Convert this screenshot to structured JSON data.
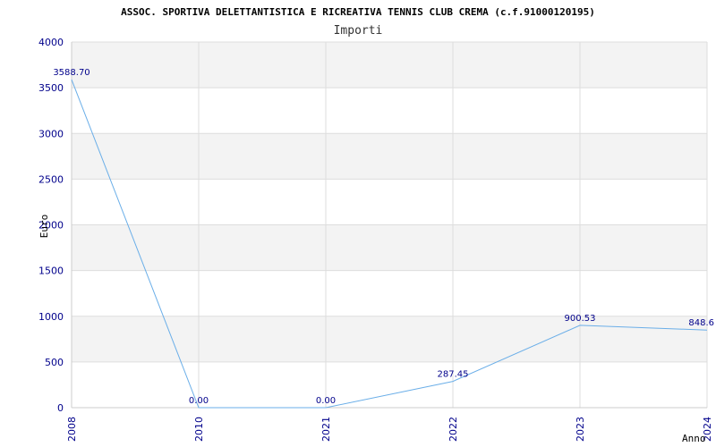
{
  "chart_data": {
    "type": "line",
    "title": "ASSOC. SPORTIVA DELETTANTISTICA E RICREATIVA TENNIS CLUB CREMA (c.f.91000120195)",
    "subtitle": "Importi",
    "xlabel": "Anno",
    "ylabel": "Euro",
    "categories": [
      "2008",
      "2010",
      "2021",
      "2022",
      "2023",
      "2024"
    ],
    "series": [
      {
        "values": [
          3588.7,
          0.0,
          0.0,
          287.45,
          900.53,
          848.6
        ],
        "labels": [
          "3588.70",
          "0.00",
          "0.00",
          "287.45",
          "900.53",
          "848.6"
        ]
      }
    ],
    "ylim": [
      0,
      4000
    ],
    "yticks": [
      0,
      500,
      1000,
      1500,
      2000,
      2500,
      3000,
      3500,
      4000
    ],
    "grid": true,
    "band_colors": [
      "#f3f3f3",
      "#ffffff"
    ],
    "line_color": "#6aaee8",
    "tick_color": "#00008b"
  }
}
